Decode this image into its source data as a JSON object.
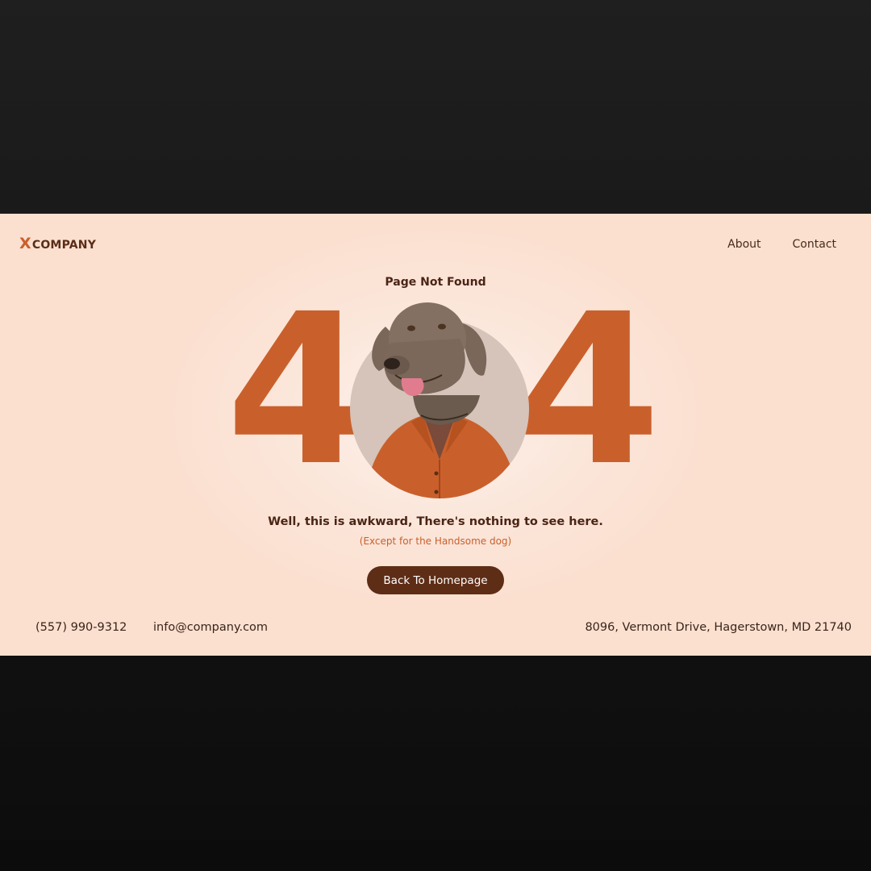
{
  "header": {
    "logo_mark": "X",
    "logo_text": "COMPANY",
    "nav": [
      {
        "label": "About"
      },
      {
        "label": "Contact"
      }
    ]
  },
  "hero": {
    "subtitle": "Page Not Found",
    "left_digit": "4",
    "right_digit": "4",
    "image": "dog-in-orange-shirt",
    "message": "Well, this is awkward, There's nothing to see here.",
    "aside": "(Except for the Handsome dog)",
    "button_label": "Back To Homepage"
  },
  "footer": {
    "phone": "(557) 990-9312",
    "email": "info@company.com",
    "address": "8096, Vermont Drive, Hagerstown, MD 21740"
  },
  "colors": {
    "accent": "#c9602c",
    "dark_brown": "#5e2d16",
    "background": "#fbe3d5"
  }
}
